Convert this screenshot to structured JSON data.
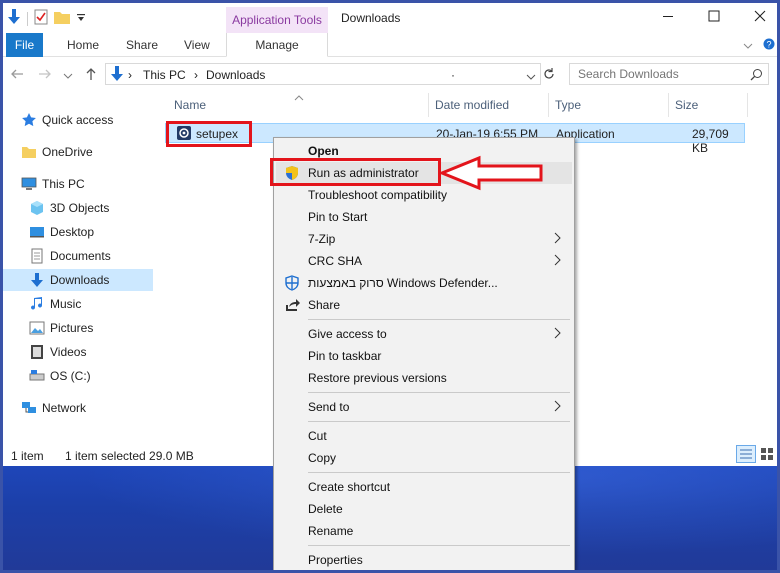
{
  "title_bar": {
    "context_tab_title": "Application Tools",
    "window_title": "Downloads"
  },
  "ribbon": {
    "tabs": [
      "File",
      "Home",
      "Share",
      "View",
      "Manage"
    ]
  },
  "address_bar": {
    "path": [
      "This PC",
      "Downloads"
    ],
    "dot": "·",
    "search_placeholder": "Search Downloads"
  },
  "nav_pane": {
    "items": [
      {
        "label": "Quick access",
        "icon": "star-icon"
      },
      {
        "label": "OneDrive",
        "icon": "folder-icon"
      },
      {
        "label": "This PC",
        "icon": "computer-icon"
      },
      {
        "label": "3D Objects",
        "icon": "cube-icon"
      },
      {
        "label": "Desktop",
        "icon": "desktop-icon"
      },
      {
        "label": "Documents",
        "icon": "documents-icon"
      },
      {
        "label": "Downloads",
        "icon": "download-icon",
        "selected": true
      },
      {
        "label": "Music",
        "icon": "music-icon"
      },
      {
        "label": "Pictures",
        "icon": "pictures-icon"
      },
      {
        "label": "Videos",
        "icon": "videos-icon"
      },
      {
        "label": "OS (C:)",
        "icon": "drive-icon"
      },
      {
        "label": "Network",
        "icon": "network-icon"
      }
    ]
  },
  "file_list": {
    "columns": [
      "Name",
      "Date modified",
      "Type",
      "Size"
    ],
    "rows": [
      {
        "name": "setupex",
        "date": "20-Jan-19 6:55 PM",
        "type": "Application",
        "size": "29,709 KB"
      }
    ]
  },
  "status_bar": {
    "count": "1 item",
    "selection": "1 item selected  29.0 MB"
  },
  "context_menu": {
    "items": [
      {
        "label": "Open",
        "bold": true
      },
      {
        "label": "Run as administrator",
        "icon": "shield-icon",
        "highlighted": true
      },
      {
        "label": "Troubleshoot compatibility"
      },
      {
        "label": "Pin to Start"
      },
      {
        "label": "7-Zip",
        "submenu": true
      },
      {
        "label": "CRC SHA",
        "submenu": true
      },
      {
        "label": "סרוק באמצעות Windows Defender...",
        "icon": "defender-icon"
      },
      {
        "label": "Share",
        "icon": "share-icon"
      },
      {
        "label": "Give access to",
        "submenu": true
      },
      {
        "label": "Pin to taskbar"
      },
      {
        "label": "Restore previous versions"
      },
      {
        "label": "Send to",
        "submenu": true
      },
      {
        "label": "Cut"
      },
      {
        "label": "Copy"
      },
      {
        "label": "Create shortcut"
      },
      {
        "label": "Delete"
      },
      {
        "label": "Rename"
      },
      {
        "label": "Properties"
      }
    ]
  },
  "colors": {
    "accent": "#1979ca",
    "selection": "#cce8ff",
    "annotation_red": "#e3141b",
    "context_tab": "#f3e3f7"
  }
}
